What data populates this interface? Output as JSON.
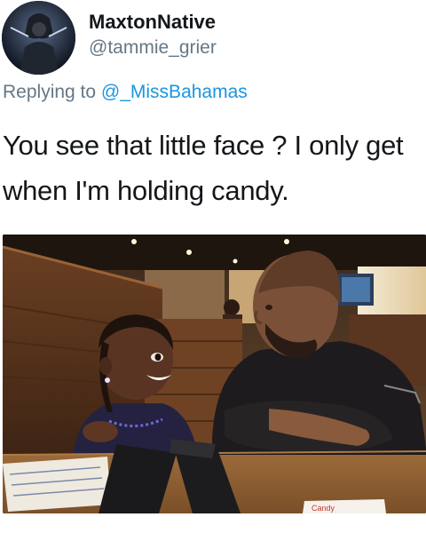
{
  "tweet": {
    "display_name": "MaxtonNative",
    "handle": "@tammie_grier",
    "reply_prefix": "Replying to",
    "reply_to": "@_MissBahamas",
    "text_line1": "You see that little face ? I only get",
    "text_line2": "when I'm holding candy."
  },
  "photo": {
    "menu_card_text": "Candy",
    "subject": "girl-and-man-at-restaurant-table"
  },
  "colors": {
    "text_primary": "#14171a",
    "text_secondary": "#657786",
    "link": "#1b95e0"
  }
}
